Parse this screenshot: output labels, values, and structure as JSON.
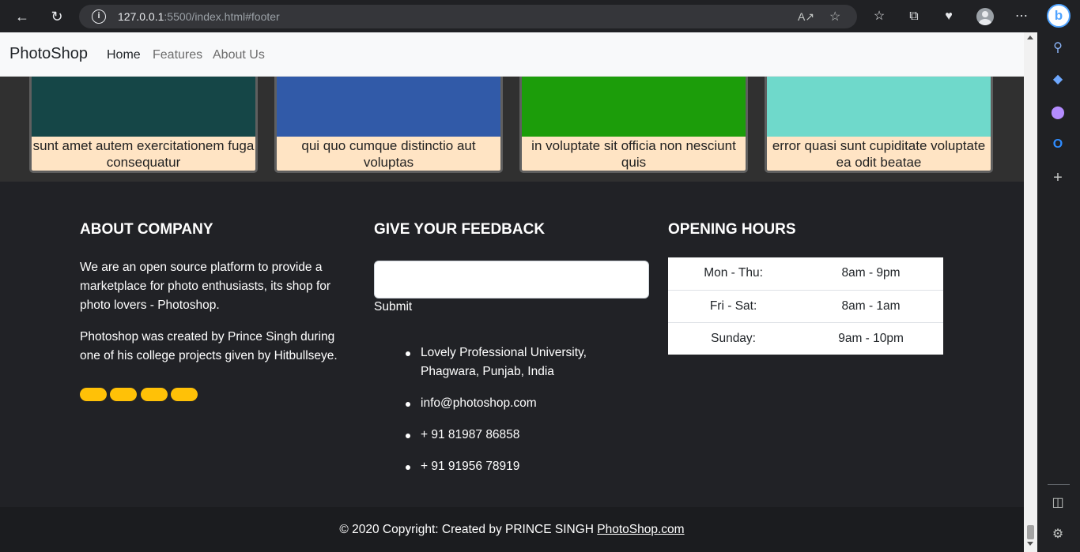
{
  "browser": {
    "url_host": "127.0.0.1",
    "url_rest": ":5500/index.html#footer"
  },
  "navbar": {
    "brand": "PhotoShop",
    "links": [
      "Home",
      "Features",
      "About Us"
    ]
  },
  "cards": [
    {
      "caption": "sunt amet autem exercitationem fuga consequatur",
      "color": "#154647"
    },
    {
      "caption": "qui quo cumque distinctio aut voluptas",
      "color": "#315aa8"
    },
    {
      "caption": "in voluptate sit officia non nesciunt quis",
      "color": "#1c9d0a"
    },
    {
      "caption": "error quasi sunt cupiditate voluptate ea odit beatae",
      "color": "#6fd9cb"
    }
  ],
  "footer": {
    "about": {
      "heading": "ABOUT COMPANY",
      "para1": "We are an open source platform to provide a marketplace for photo enthusiasts, its shop for photo lovers - Photoshop.",
      "para2": "Photoshop was created by Prince Singh during one of his college projects given by Hitbullseye."
    },
    "feedback": {
      "heading": "GIVE YOUR FEEDBACK",
      "input_value": "",
      "submit_label": "Submit",
      "contacts": [
        "Lovely Professional University, Phagwara, Punjab, India",
        "info@photoshop.com",
        "+ 91 81987 86858",
        "+ 91 91956 78919"
      ]
    },
    "hours": {
      "heading": "OPENING HOURS",
      "rows": [
        {
          "day": "Mon - Thu:",
          "time": "8am - 9pm"
        },
        {
          "day": "Fri - Sat:",
          "time": "8am - 1am"
        },
        {
          "day": "Sunday:",
          "time": "9am - 10pm"
        }
      ]
    },
    "copyright_text": "© 2020 Copyright: Created by PRINCE SINGH ",
    "copyright_link": "PhotoShop.com"
  },
  "colors": {
    "accent_social": "#ffc107",
    "caption_bg": "#ffe4c4",
    "footer_bg": "#212226"
  }
}
